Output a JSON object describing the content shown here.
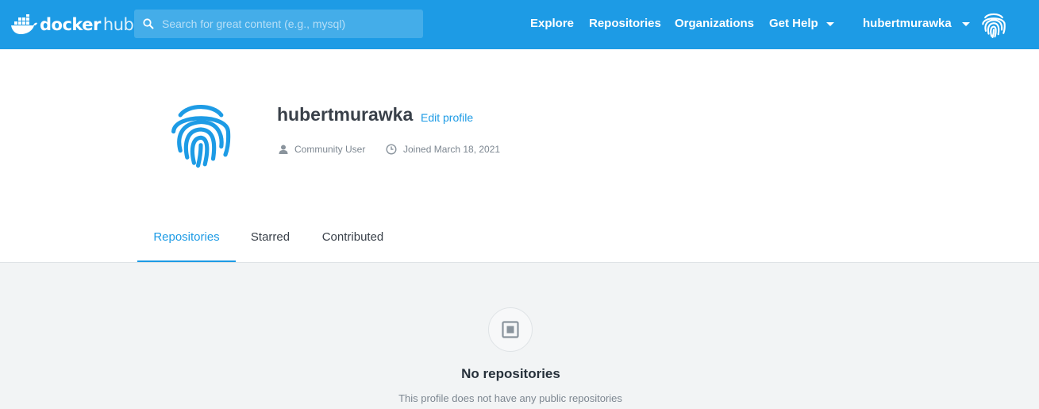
{
  "colors": {
    "brand": "#1d9be5",
    "nav_text": "#ffffff",
    "content_bg": "#f2f4f5"
  },
  "topbar": {
    "logo": {
      "docker": "docker",
      "hub": "hub",
      "icon": "docker-whale-icon"
    },
    "search": {
      "placeholder": "Search for great content (e.g., mysql)",
      "value": "",
      "icon": "search-icon"
    },
    "nav": {
      "explore": "Explore",
      "repositories": "Repositories",
      "organizations": "Organizations",
      "get_help": "Get Help"
    },
    "user": {
      "username": "hubertmurawka",
      "avatar_icon": "fingerprint-icon"
    }
  },
  "profile": {
    "username": "hubertmurawka",
    "edit_label": "Edit profile",
    "role": "Community User",
    "joined": "Joined March 18, 2021",
    "avatar_icon": "fingerprint-icon"
  },
  "tabs": [
    {
      "label": "Repositories",
      "active": true
    },
    {
      "label": "Starred",
      "active": false
    },
    {
      "label": "Contributed",
      "active": false
    }
  ],
  "empty_state": {
    "icon": "repository-icon",
    "title": "No repositories",
    "subtitle": "This profile does not have any public repositories"
  }
}
